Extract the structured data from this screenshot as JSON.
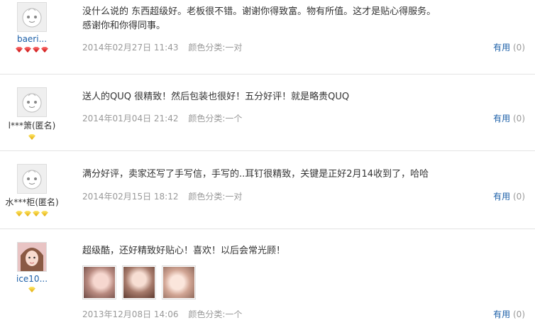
{
  "reviews": [
    {
      "user": "baeri...",
      "gems": 4,
      "gem_color": "red",
      "text": "没什么说的 东西超级好。老板很不错。谢谢你得致富。物有所值。这才是贴心得服务。感谢你和你得同事。",
      "date": "2014年02月27日 11:43",
      "color": "颜色分类:一对",
      "useful_label": "有用",
      "useful_count": "(0)"
    },
    {
      "user": "l***箫(匿名)",
      "gems": 1,
      "gem_color": "yellow",
      "text": "送人的QUQ 很精致！然后包装也很好！五分好评！就是略贵QUQ",
      "date": "2014年01月04日 21:42",
      "color": "颜色分类:一个",
      "useful_label": "有用",
      "useful_count": "(0)"
    },
    {
      "user": "水***柜(匿名)",
      "gems": 4,
      "gem_color": "yellow",
      "text": "满分好评，卖家还写了手写信，手写的..耳钉很精致，关键是正好2月14收到了，哈哈",
      "date": "2014年02月15日 18:12",
      "color": "颜色分类:一对",
      "useful_label": "有用",
      "useful_count": "(0)"
    },
    {
      "user": "ice10...",
      "gems": 1,
      "gem_color": "yellow",
      "text": "超级酷，还好精致好贴心！喜欢！以后会常光顾！",
      "date": "2013年12月08日 14:06",
      "color": "颜色分类:一个",
      "useful_label": "有用",
      "useful_count": "(0)",
      "photos": 3
    }
  ]
}
